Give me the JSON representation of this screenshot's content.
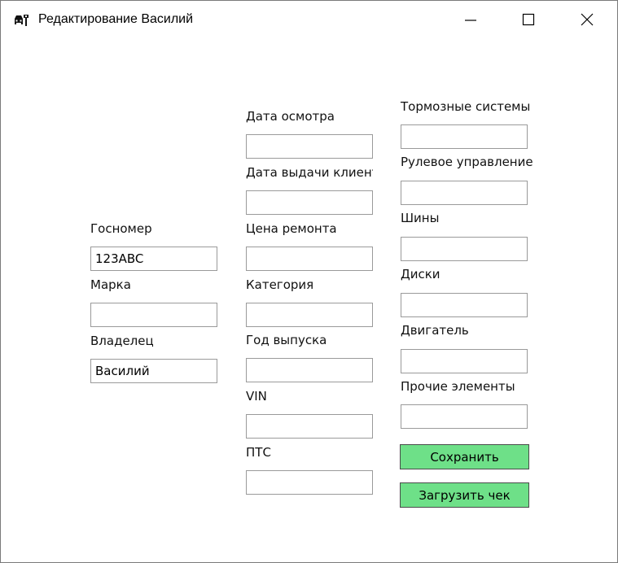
{
  "window": {
    "title": "Редактирование Василий",
    "icon": "car-service-icon"
  },
  "col1": {
    "plate": {
      "label": "Госномер",
      "value": "123ABC"
    },
    "brand": {
      "label": "Марка",
      "value": ""
    },
    "owner": {
      "label": "Владелец",
      "value": "Василий"
    }
  },
  "col2": {
    "inspect_date": {
      "label": "Дата осмотра",
      "value": ""
    },
    "issue_date": {
      "label": "Дата выдачи клиенту",
      "value": ""
    },
    "repair_price": {
      "label": "Цена ремонта",
      "value": ""
    },
    "category": {
      "label": "Категория",
      "value": ""
    },
    "year": {
      "label": "Год выпуска",
      "value": ""
    },
    "vin": {
      "label": "VIN",
      "value": ""
    },
    "pts": {
      "label": "ПТС",
      "value": ""
    }
  },
  "col3": {
    "brakes": {
      "label": "Тормозные системы",
      "value": ""
    },
    "steering": {
      "label": "Рулевое управление",
      "value": ""
    },
    "tires": {
      "label": "Шины",
      "value": ""
    },
    "wheels": {
      "label": "Диски",
      "value": ""
    },
    "engine": {
      "label": "Двигатель",
      "value": ""
    },
    "other": {
      "label": "Прочие элементы",
      "value": ""
    }
  },
  "buttons": {
    "save": "Сохранить",
    "upload_check": "Загрузить чек",
    "color": "#6ee088"
  }
}
